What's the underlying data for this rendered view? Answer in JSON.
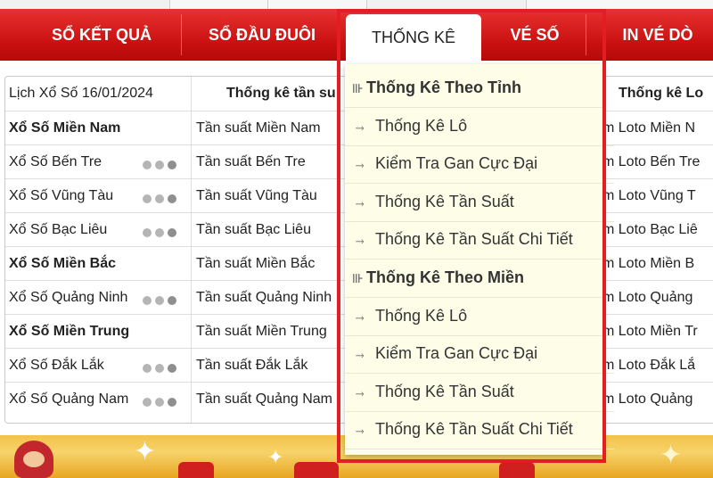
{
  "nav": {
    "items": [
      "SỔ KẾT QUẢ",
      "SỔ ĐẦU ĐUÔI",
      "THỐNG KÊ",
      "VÉ SỐ",
      "IN VÉ DÒ"
    ],
    "active_index": 2
  },
  "table": {
    "headers": [
      "Lịch Xổ Số 16/01/2024",
      "Thống kê tần su",
      "Thống kê Lo"
    ],
    "rows": [
      {
        "a": "Xổ Số Miền Nam",
        "b": "Tần suất Miền Nam",
        "c": "m Loto Miền N",
        "bold": true,
        "dots": false
      },
      {
        "a": "Xổ Số Bến Tre",
        "b": "Tần suất Bến Tre",
        "c": "m Loto Bến Tre",
        "bold": false,
        "dots": true
      },
      {
        "a": "Xổ Số Vũng Tàu",
        "b": "Tần suất Vũng Tàu",
        "c": "m Loto Vũng T",
        "bold": false,
        "dots": true
      },
      {
        "a": "Xổ Số Bạc Liêu",
        "b": "Tần suất Bạc Liêu",
        "c": "m Loto Bạc Liê",
        "bold": false,
        "dots": true
      },
      {
        "a": "Xổ Số Miền Bắc",
        "b": "Tần suất Miền Bắc",
        "c": "m Loto Miền B",
        "bold": true,
        "dots": false
      },
      {
        "a": "Xổ Số Quảng Ninh",
        "b": "Tần suất Quảng Ninh",
        "c": "m Loto Quảng",
        "bold": false,
        "dots": true
      },
      {
        "a": "Xổ Số Miền Trung",
        "b": "Tần suất Miền Trung",
        "c": "m Loto Miền Tr",
        "bold": true,
        "dots": false
      },
      {
        "a": "Xổ Số Đắk Lắk",
        "b": "Tần suất Đắk Lắk",
        "c": "m Loto Đắk Lắ",
        "bold": false,
        "dots": true
      },
      {
        "a": "Xổ Số Quảng Nam",
        "b": "Tần suất Quảng Nam",
        "c": "m Loto Quảng",
        "bold": false,
        "dots": true
      }
    ]
  },
  "dropdown": {
    "items": [
      {
        "label": "Thống Kê Theo Tỉnh",
        "type": "header"
      },
      {
        "label": "Thống Kê Lô",
        "type": "sub"
      },
      {
        "label": "Kiểm Tra Gan Cực Đại",
        "type": "sub"
      },
      {
        "label": "Thống Kê Tần Suất",
        "type": "sub"
      },
      {
        "label": "Thống Kê Tần Suất Chi Tiết",
        "type": "sub"
      },
      {
        "label": "Thống Kê Theo Miền",
        "type": "header"
      },
      {
        "label": "Thống Kê Lô",
        "type": "sub"
      },
      {
        "label": "Kiểm Tra Gan Cực Đại",
        "type": "sub"
      },
      {
        "label": "Thống Kê Tần Suất",
        "type": "sub"
      },
      {
        "label": "Thống Kê Tần Suất Chi Tiết",
        "type": "sub"
      }
    ]
  },
  "colors": {
    "nav_red": "#c70f0f",
    "highlight_border": "#e41d23",
    "dropdown_bg": "#fdfde8"
  },
  "icons": {
    "header_icon": "arrow-tree-icon",
    "sub_icon": "dotted-arrow-icon"
  }
}
